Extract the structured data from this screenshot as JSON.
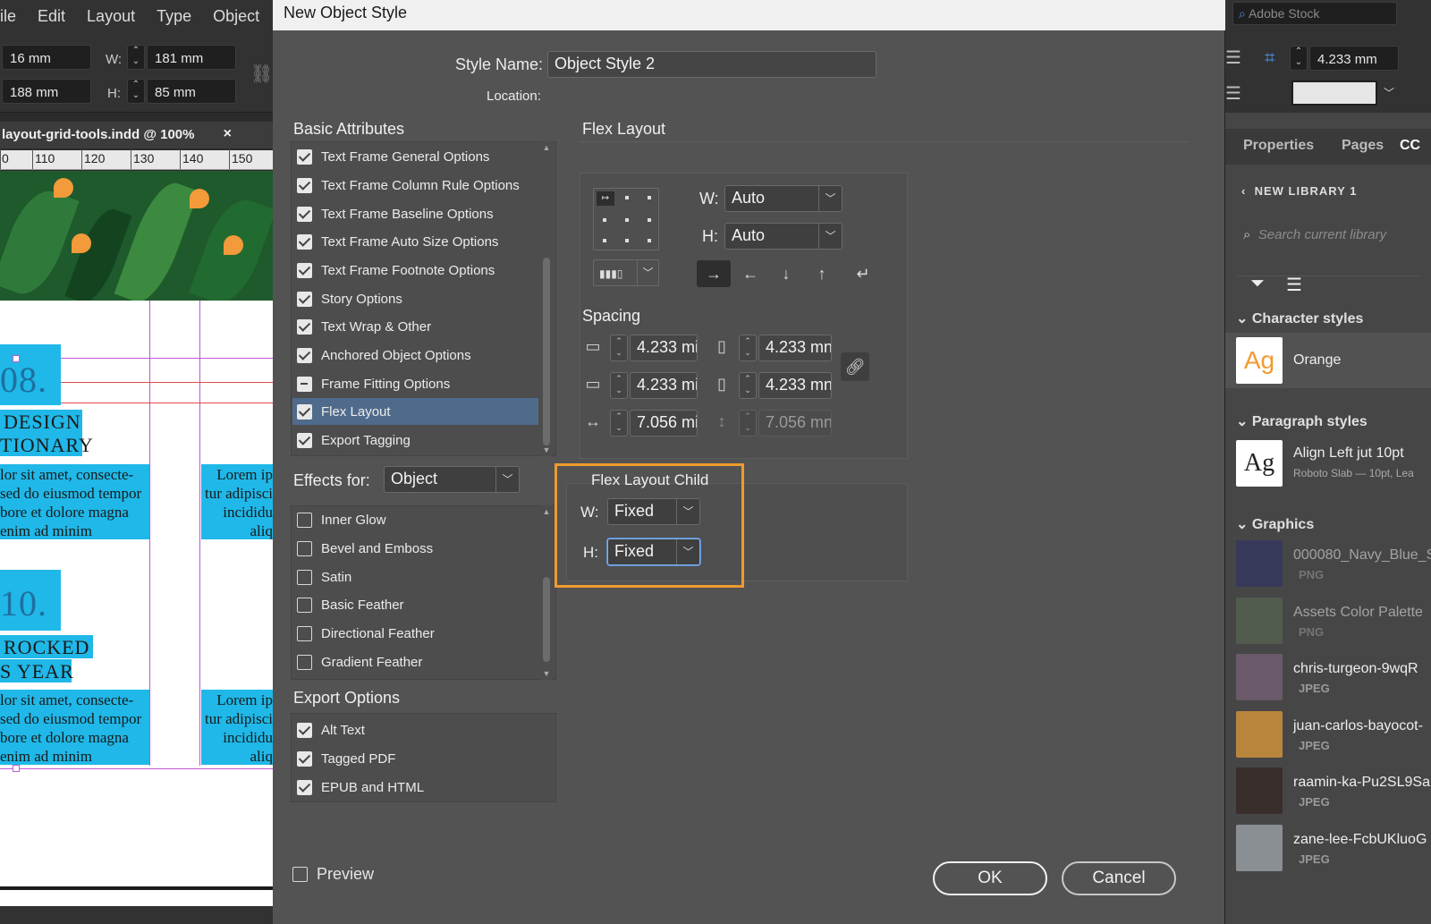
{
  "menubar": {
    "items": [
      "ile",
      "Edit",
      "Layout",
      "Type",
      "Object"
    ]
  },
  "control": {
    "x_val": "16 mm",
    "y_val": "188 mm",
    "w_label": "W:",
    "h_label": "H:",
    "w_val": "181 mm",
    "h_val": "85 mm"
  },
  "document": {
    "tab_title": "layout-grid-tools.indd @ 100%",
    "close": "×",
    "ruler": [
      "0",
      "110",
      "120",
      "130",
      "140",
      "150"
    ]
  },
  "canvas": {
    "num1": "08.",
    "head1a": "DESIGN",
    "head1b": "TIONARY",
    "body1": [
      "lor sit amet, consecte-",
      "sed do eiusmod tempor",
      "bore et dolore magna",
      "enim ad minim"
    ],
    "body1b": [
      "Lorem ip",
      "tur adipisci",
      "incididu",
      "aliq"
    ],
    "num2": "10.",
    "head2a": "ROCKED",
    "head2b": "S YEAR",
    "body2": [
      "lor sit amet, consecte-",
      "sed do eiusmod tempor",
      "bore et dolore magna",
      "enim ad minim"
    ],
    "body2b": [
      "Lorem ip",
      "tur adipisci",
      "incididu",
      "aliq"
    ]
  },
  "dialog": {
    "title": "New Object Style",
    "style_name_label": "Style Name:",
    "style_name_value": "Object Style 2",
    "location_label": "Location:",
    "basic_attributes_label": "Basic Attributes",
    "basic_attributes": [
      {
        "label": "Text Frame General Options",
        "state": "on"
      },
      {
        "label": "Text Frame Column Rule Options",
        "state": "on"
      },
      {
        "label": "Text Frame Baseline Options",
        "state": "on"
      },
      {
        "label": "Text Frame Auto Size Options",
        "state": "on"
      },
      {
        "label": "Text Frame Footnote Options",
        "state": "on"
      },
      {
        "label": "Story Options",
        "state": "on"
      },
      {
        "label": "Text Wrap & Other",
        "state": "on"
      },
      {
        "label": "Anchored Object Options",
        "state": "on"
      },
      {
        "label": "Frame Fitting Options",
        "state": "mixed"
      },
      {
        "label": "Flex Layout",
        "state": "on",
        "selected": true
      },
      {
        "label": "Export Tagging",
        "state": "on"
      }
    ],
    "effects_for_label": "Effects for:",
    "effects_for_value": "Object",
    "effects": [
      "Inner Glow",
      "Bevel and Emboss",
      "Satin",
      "Basic Feather",
      "Directional Feather",
      "Gradient Feather"
    ],
    "export_options_label": "Export Options",
    "export_options": [
      "Alt Text",
      "Tagged PDF",
      "EPUB and HTML"
    ],
    "preview_label": "Preview",
    "ok_label": "OK",
    "cancel_label": "Cancel",
    "flex": {
      "title": "Flex Layout",
      "w_label": "W:",
      "w_value": "Auto",
      "h_label": "H:",
      "h_value": "Auto",
      "spacing_label": "Spacing",
      "top": "4.233 mi",
      "left": "4.233 mn",
      "bottom": "4.233 mi",
      "right": "4.233 mn",
      "gap_h": "7.056 mi",
      "gap_v": "7.056 mn"
    },
    "child": {
      "title": "Flex Layout Child",
      "w_label": "W:",
      "w_value": "Fixed",
      "h_label": "H:",
      "h_value": "Fixed"
    }
  },
  "rightpanel": {
    "stock_placeholder": "Adobe Stock",
    "stroke_val": "4.233 mm",
    "tabs": [
      "Properties",
      "Pages",
      "CC"
    ],
    "library_name": "NEW LIBRARY 1",
    "search_placeholder": "Search current library",
    "char_styles_label": "Character styles",
    "char_style_name": "Orange",
    "ag": "Ag",
    "para_styles_label": "Paragraph styles",
    "para_style_name": "Align Left jut 10pt",
    "para_style_sub": "Roboto Slab — 10pt, Lea",
    "graphics_label": "Graphics",
    "graphics": [
      {
        "name": "000080_Navy_Blue_S",
        "type": "PNG",
        "color": "#2b2f6b"
      },
      {
        "name": "Assets Color Palette",
        "type": "PNG",
        "color": "#5b6e56"
      },
      {
        "name": "chris-turgeon-9wqR",
        "type": "JPEG",
        "color": "#6b5a6a"
      },
      {
        "name": "juan-carlos-bayocot-",
        "type": "JPEG",
        "color": "#b9853c"
      },
      {
        "name": "raamin-ka-Pu2SL9Sa",
        "type": "JPEG",
        "color": "#3a2e2c"
      },
      {
        "name": "zane-lee-FcbUKluoG",
        "type": "JPEG",
        "color": "#8a8f94"
      }
    ]
  },
  "colors": {
    "accent": "#f09a2e",
    "selection": "#4f6b8c",
    "cyan": "#1fb8e8"
  }
}
